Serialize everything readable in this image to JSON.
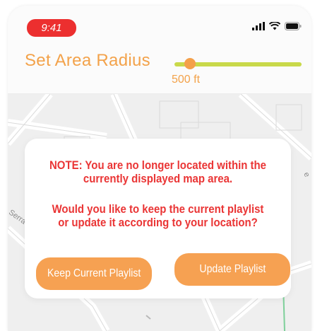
{
  "status_bar": {
    "time": "9:41",
    "icons": [
      "signal-bars-icon",
      "wifi-icon",
      "battery-icon"
    ],
    "time_pill_color": "#ec2f2f"
  },
  "header": {
    "title": "Set Area Radius",
    "slider_value_label": "500 ft",
    "slider_fraction": 0.15,
    "accent_color": "#f3a24a",
    "track_color": "#c9d94a"
  },
  "map": {
    "street_label": "Serra",
    "edge_label": "e"
  },
  "dialog": {
    "note": "NOTE: You are no longer located within the currently displayed map area.",
    "question": "Would you like to keep the current playlist or update it according to your location?",
    "keep_button": "Keep Current Playlist",
    "update_button": "Update Playlist",
    "text_color": "#ea3535",
    "button_color": "#f6a152"
  }
}
